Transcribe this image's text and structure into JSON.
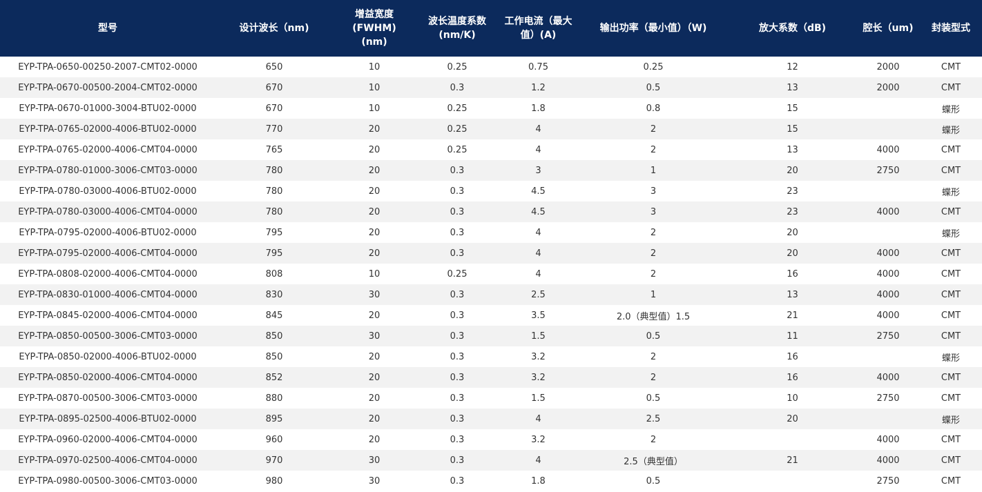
{
  "colors": {
    "header_bg": "#0c2a5c",
    "header_text": "#ffffff",
    "row_alt_bg": "#f2f2f2",
    "body_text": "#333333"
  },
  "table": {
    "headers": [
      "型号",
      "设计波长（nm)",
      "增益宽度\n(FWHM)\n(nm)",
      "波长温度系数\n(nm/K)",
      "工作电流（最大\n值）(A)",
      "输出功率（最小值）（W)",
      "放大系数（dB)",
      "腔长（um)",
      "封装型式"
    ],
    "rows": [
      [
        "EYP-TPA-0650-00250-2007-CMT02-0000",
        "650",
        "10",
        "0.25",
        "0.75",
        "0.25",
        "12",
        "2000",
        "CMT"
      ],
      [
        "EYP-TPA-0670-00500-2004-CMT02-0000",
        "670",
        "10",
        "0.3",
        "1.2",
        "0.5",
        "13",
        "2000",
        "CMT"
      ],
      [
        "EYP-TPA-0670-01000-3004-BTU02-0000",
        "670",
        "10",
        "0.25",
        "1.8",
        "0.8",
        "15",
        "",
        "蝶形"
      ],
      [
        "EYP-TPA-0765-02000-4006-BTU02-0000",
        "770",
        "20",
        "0.25",
        "4",
        "2",
        "15",
        "",
        "蝶形"
      ],
      [
        "EYP-TPA-0765-02000-4006-CMT04-0000",
        "765",
        "20",
        "0.25",
        "4",
        "2",
        "13",
        "4000",
        "CMT"
      ],
      [
        "EYP-TPA-0780-01000-3006-CMT03-0000",
        "780",
        "20",
        "0.3",
        "3",
        "1",
        "20",
        "2750",
        "CMT"
      ],
      [
        "EYP-TPA-0780-03000-4006-BTU02-0000",
        "780",
        "20",
        "0.3",
        "4.5",
        "3",
        "23",
        "",
        "蝶形"
      ],
      [
        "EYP-TPA-0780-03000-4006-CMT04-0000",
        "780",
        "20",
        "0.3",
        "4.5",
        "3",
        "23",
        "4000",
        "CMT"
      ],
      [
        "EYP-TPA-0795-02000-4006-BTU02-0000",
        "795",
        "20",
        "0.3",
        "4",
        "2",
        "20",
        "",
        "蝶形"
      ],
      [
        "EYP-TPA-0795-02000-4006-CMT04-0000",
        "795",
        "20",
        "0.3",
        "4",
        "2",
        "20",
        "4000",
        "CMT"
      ],
      [
        "EYP-TPA-0808-02000-4006-CMT04-0000",
        "808",
        "10",
        "0.25",
        "4",
        "2",
        "16",
        "4000",
        "CMT"
      ],
      [
        "EYP-TPA-0830-01000-4006-CMT04-0000",
        "830",
        "30",
        "0.3",
        "2.5",
        "1",
        "13",
        "4000",
        "CMT"
      ],
      [
        "EYP-TPA-0845-02000-4006-CMT04-0000",
        "845",
        "20",
        "0.3",
        "3.5",
        "2.0（典型值）1.5",
        "21",
        "4000",
        "CMT"
      ],
      [
        "EYP-TPA-0850-00500-3006-CMT03-0000",
        "850",
        "30",
        "0.3",
        "1.5",
        "0.5",
        "11",
        "2750",
        "CMT"
      ],
      [
        "EYP-TPA-0850-02000-4006-BTU02-0000",
        "850",
        "20",
        "0.3",
        "3.2",
        "2",
        "16",
        "",
        "蝶形"
      ],
      [
        "EYP-TPA-0850-02000-4006-CMT04-0000",
        "852",
        "20",
        "0.3",
        "3.2",
        "2",
        "16",
        "4000",
        "CMT"
      ],
      [
        "EYP-TPA-0870-00500-3006-CMT03-0000",
        "880",
        "20",
        "0.3",
        "1.5",
        "0.5",
        "10",
        "2750",
        "CMT"
      ],
      [
        "EYP-TPA-0895-02500-4006-BTU02-0000",
        "895",
        "20",
        "0.3",
        "4",
        "2.5",
        "20",
        "",
        "蝶形"
      ],
      [
        "EYP-TPA-0960-02000-4006-CMT04-0000",
        "960",
        "20",
        "0.3",
        "3.2",
        "2",
        "",
        "4000",
        "CMT"
      ],
      [
        "EYP-TPA-0970-02500-4006-CMT04-0000",
        "970",
        "30",
        "0.3",
        "4",
        "2.5（典型值）",
        "21",
        "4000",
        "CMT"
      ],
      [
        "EYP-TPA-0980-00500-3006-CMT03-0000",
        "980",
        "30",
        "0.3",
        "1.8",
        "0.5",
        "",
        "2750",
        "CMT"
      ]
    ]
  }
}
